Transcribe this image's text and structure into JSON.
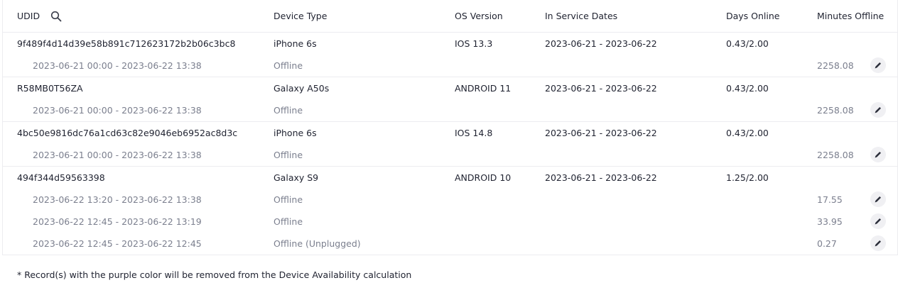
{
  "header": {
    "udid": "UDID",
    "device_type": "Device Type",
    "os_version": "OS Version",
    "in_service_dates": "In Service Dates",
    "days_online": "Days Online",
    "minutes_offline": "Minutes Offline"
  },
  "devices": [
    {
      "udid": "9f489f4d14d39e58b891c712623172b2b06c3bc8",
      "device_type": "iPhone 6s",
      "os_version": "IOS 13.3",
      "in_service_dates": "2023-06-21 - 2023-06-22",
      "days_online": "0.43/2.00",
      "records": [
        {
          "range": "2023-06-21 00:00 - 2023-06-22 13:38",
          "status": "Offline",
          "minutes": "2258.08"
        }
      ]
    },
    {
      "udid": "R58MB0T56ZA",
      "device_type": "Galaxy A50s",
      "os_version": "ANDROID 11",
      "in_service_dates": "2023-06-21 - 2023-06-22",
      "days_online": "0.43/2.00",
      "records": [
        {
          "range": "2023-06-21 00:00 - 2023-06-22 13:38",
          "status": "Offline",
          "minutes": "2258.08"
        }
      ]
    },
    {
      "udid": "4bc50e9816dc76a1cd63c82e9046eb6952ac8d3c",
      "device_type": "iPhone 6s",
      "os_version": "IOS 14.8",
      "in_service_dates": "2023-06-21 - 2023-06-22",
      "days_online": "0.43/2.00",
      "records": [
        {
          "range": "2023-06-21 00:00 - 2023-06-22 13:38",
          "status": "Offline",
          "minutes": "2258.08"
        }
      ]
    },
    {
      "udid": "494f344d59563398",
      "device_type": "Galaxy S9",
      "os_version": "ANDROID 10",
      "in_service_dates": "2023-06-21 - 2023-06-22",
      "days_online": "1.25/2.00",
      "records": [
        {
          "range": "2023-06-22 13:20 - 2023-06-22 13:38",
          "status": "Offline",
          "minutes": "17.55"
        },
        {
          "range": "2023-06-22 12:45 - 2023-06-22 13:19",
          "status": "Offline",
          "minutes": "33.95"
        },
        {
          "range": "2023-06-22 12:45 - 2023-06-22 12:45",
          "status": "Offline (Unplugged)",
          "minutes": "0.27"
        }
      ]
    }
  ],
  "footnote": "* Record(s) with the purple color will be removed from the Device Availability calculation",
  "icons": {
    "search": "search-icon",
    "edit": "pencil-icon"
  },
  "colors": {
    "primary_text": "#1f2230",
    "secondary_text": "#7b7f8e",
    "divider": "#ececf0",
    "edit_bg": "#f0f0f3"
  }
}
